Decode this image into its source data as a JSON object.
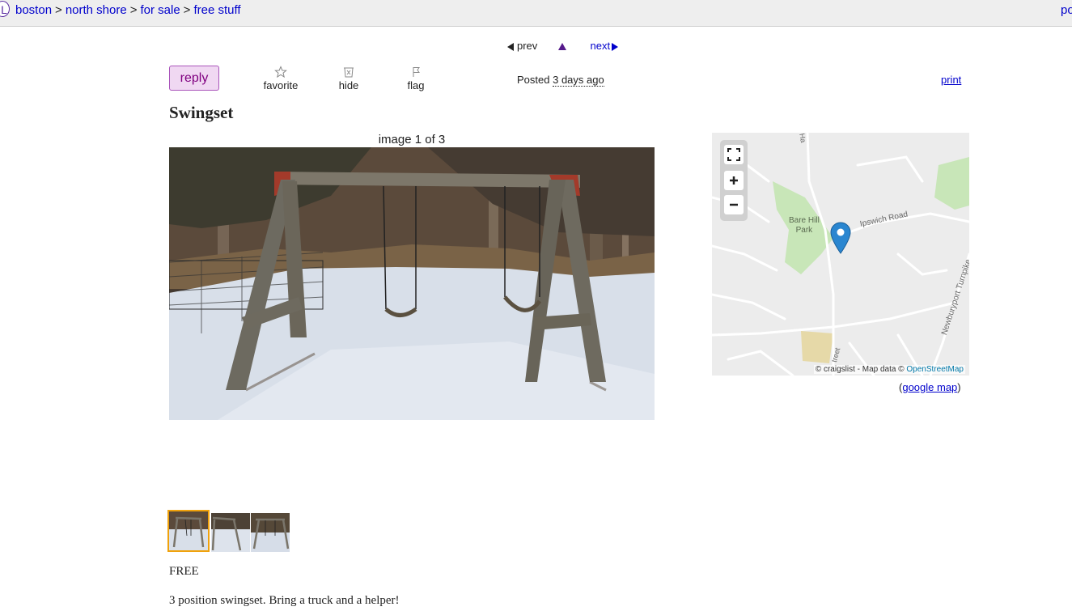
{
  "breadcrumbs": {
    "logo": "L",
    "items": [
      "boston",
      "north shore",
      "for sale",
      "free stuff"
    ],
    "separator": ">",
    "right_fragment": "po"
  },
  "nav": {
    "prev": "prev",
    "next": "next"
  },
  "actions": {
    "reply": "reply",
    "favorite": "favorite",
    "hide": "hide",
    "flag": "flag"
  },
  "posted": {
    "label": "Posted",
    "ago": "3 days ago"
  },
  "print": "print",
  "title": "Swingset",
  "gallery": {
    "image_count": "image 1 of 3",
    "thumbnails": 3,
    "selected": 1
  },
  "map": {
    "labels": {
      "park": [
        "Bare Hill",
        "Park"
      ],
      "road1": "Ipswich Road",
      "road2": "Newburyport Turnpike",
      "road3": "treet",
      "road4": "Ha"
    },
    "attribution": "© craigslist - Map data ©",
    "attribution_link": "OpenStreetMap",
    "google_link": "google map"
  },
  "price": "FREE",
  "body": "3 position swingset. Bring a truck and a helper!",
  "colors": {
    "link": "#0000cc",
    "reply_bg": "#f0d8f2",
    "reply_text": "#800080",
    "thumb_selected": "#f0a20c",
    "marker": "#2a86d0"
  }
}
